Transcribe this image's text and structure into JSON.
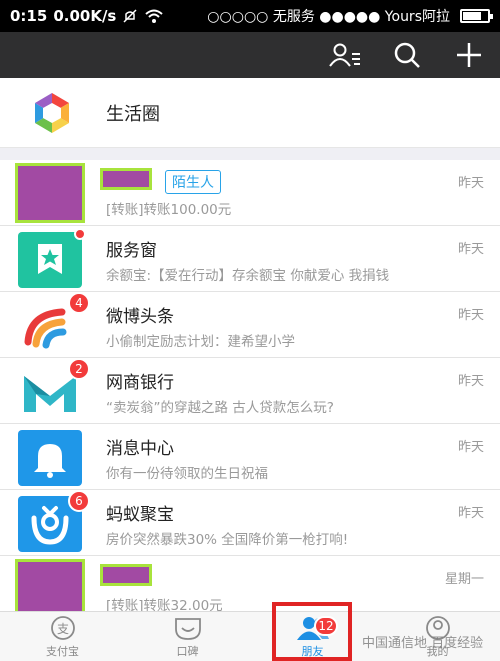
{
  "status_bar": {
    "time": "0:15",
    "speed": "0.00K/s",
    "carrier": "○○○○○ 无服务 ●●●●● Yours阿拉"
  },
  "app_bar": {
    "icons": [
      "contacts-icon",
      "search-icon",
      "add-icon"
    ]
  },
  "life_circle": {
    "title": "生活圈"
  },
  "conversations": [
    {
      "name": "",
      "tag": "陌生人",
      "preview": "[转账]转账100.00元",
      "time": "昨天",
      "avatar": "redacted",
      "badge": ""
    },
    {
      "name": "服务窗",
      "tag": "",
      "preview": "余额宝:【爱在行动】存余额宝 你献爱心 我捐钱",
      "time": "昨天",
      "avatar": "service-window",
      "badge": "dot"
    },
    {
      "name": "微博头条",
      "tag": "",
      "preview": "小偷制定励志计划：建希望小学",
      "time": "昨天",
      "avatar": "weibo",
      "badge": "4"
    },
    {
      "name": "网商银行",
      "tag": "",
      "preview": "“卖炭翁”的穿越之路 古人贷款怎么玩?",
      "time": "昨天",
      "avatar": "mybank",
      "badge": "2"
    },
    {
      "name": "消息中心",
      "tag": "",
      "preview": "你有一份待领取的生日祝福",
      "time": "昨天",
      "avatar": "message-center",
      "badge": ""
    },
    {
      "name": "蚂蚁聚宝",
      "tag": "",
      "preview": "房价突然暴跌30% 全国降价第一枪打响!",
      "time": "昨天",
      "avatar": "ant-fortune",
      "badge": "6"
    },
    {
      "name": "",
      "tag": "",
      "preview": "[转账]转账32.00元",
      "time": "星期一",
      "avatar": "redacted",
      "badge": ""
    }
  ],
  "bottom_nav": [
    {
      "label": "支付宝",
      "icon": "alipay-icon",
      "active": false
    },
    {
      "label": "口碑",
      "icon": "koubei-icon",
      "active": false
    },
    {
      "label": "朋友",
      "icon": "friends-icon",
      "active": true,
      "badge": "12"
    },
    {
      "label": "我的",
      "icon": "me-icon",
      "active": false
    }
  ],
  "watermark": "中国通信地 百度经验",
  "colors": {
    "accent": "#1d8fe3",
    "badge": "#f23b3b",
    "highlight": "#e02424",
    "redaction": "#a24aa3",
    "redaction_border": "#a8e33c"
  }
}
